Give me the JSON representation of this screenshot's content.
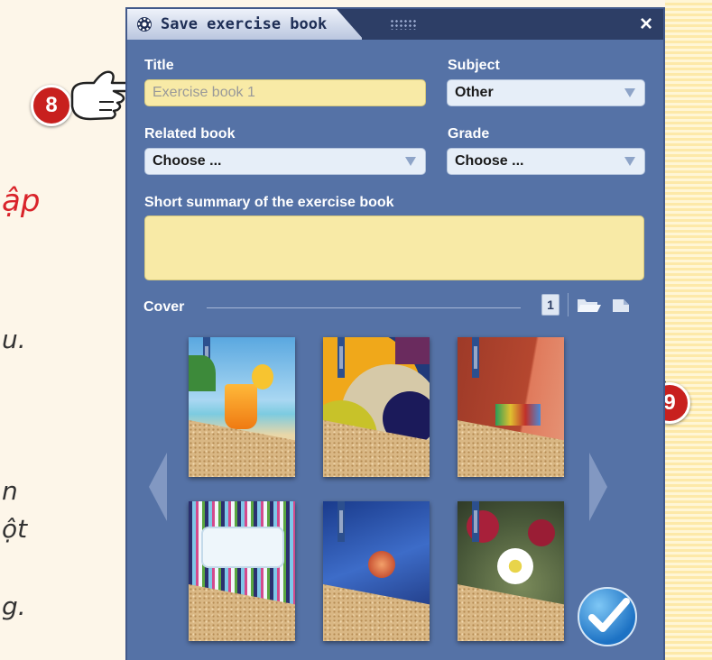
{
  "background": {
    "fragments": [
      "ập",
      "u.",
      "n",
      "ột",
      "g."
    ]
  },
  "callouts": [
    "8",
    "9"
  ],
  "dialog": {
    "title": "Save exercise book",
    "close": "×",
    "title_label": "Title",
    "title_placeholder": "Exercise book 1",
    "subject_label": "Subject",
    "subject_value": "Other",
    "related_label": "Related book",
    "related_value": "Choose ...",
    "grade_label": "Grade",
    "grade_value": "Choose ...",
    "summary_label": "Short summary of the exercise book",
    "cover_label": "Cover",
    "page_number": "1"
  },
  "colors": {
    "dialog_bg": "#5572a6",
    "titlebar": "#2d3e66",
    "input_yellow": "#f8eaa6",
    "callout_red": "#c8201e"
  },
  "covers": [
    {
      "name": "beach-juice-cover",
      "selected": true
    },
    {
      "name": "abstract-circles-cover",
      "selected": false
    },
    {
      "name": "red-hats-cover",
      "selected": false
    },
    {
      "name": "striped-cover",
      "selected": false
    },
    {
      "name": "blue-splash-cover",
      "selected": false
    },
    {
      "name": "frost-flower-cover",
      "selected": false
    }
  ]
}
